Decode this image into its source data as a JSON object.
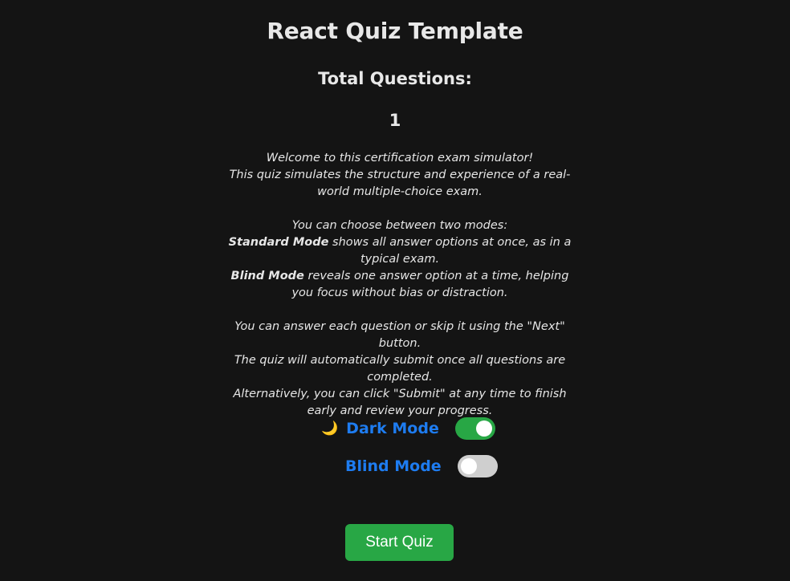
{
  "header": {
    "title": "React Quiz Template",
    "total_label": "Total Questions:",
    "total_count": "1"
  },
  "intro": {
    "p1_line1": "Welcome to this certification exam simulator!",
    "p1_line2": "This quiz simulates the structure and experience of a real-world multiple-choice exam.",
    "p2_line1": "You can choose between two modes:",
    "standard_term": "Standard Mode",
    "standard_desc": " shows all answer options at once, as in a typical exam.",
    "blind_term": "Blind Mode",
    "blind_desc": " reveals one answer option at a time, helping you focus without bias or distraction.",
    "p3_line1": "You can answer each question or skip it using the \"Next\" button.",
    "p3_line2": "The quiz will automatically submit once all questions are completed.",
    "p3_line3": "Alternatively, you can click \"Submit\" at any time to finish early and review your progress."
  },
  "toggles": {
    "dark_mode": {
      "icon": "moon-icon",
      "glyph": "🌙",
      "label": "Dark Mode",
      "on": true
    },
    "blind_mode": {
      "label": "Blind Mode",
      "on": false
    }
  },
  "actions": {
    "start_label": "Start Quiz"
  },
  "colors": {
    "background": "#141414",
    "accent_blue": "#1e7cf0",
    "success_green": "#28a745",
    "toggle_off": "#cfcfcf"
  }
}
